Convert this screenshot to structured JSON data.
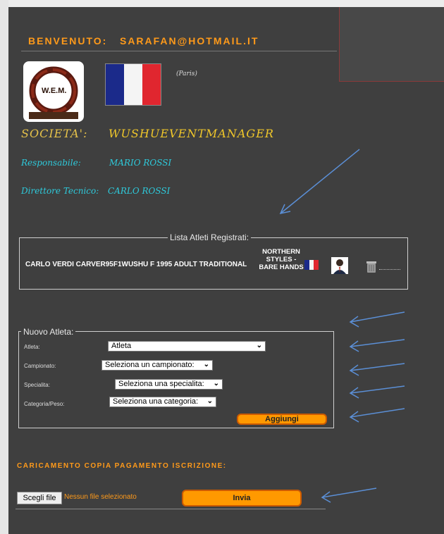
{
  "header": {
    "welcome_label": "BENVENUTO:",
    "user_email": "SARAFAN@HOTMAIL.IT"
  },
  "logo": {
    "text": "W.E.M."
  },
  "location": {
    "city": "(Paris)"
  },
  "society": {
    "societa_label": "SOCIETA':",
    "societa_value": "WUSHUEVENTMANAGER",
    "responsabile_label": "Responsabile:",
    "responsabile_value": "MARIO ROSSI",
    "direttore_label": "Direttore Tecnico:",
    "direttore_value": "CARLO ROSSI"
  },
  "registered": {
    "legend": "Lista Atleti Registrati:",
    "rows": [
      {
        "text": "CARLO VERDI CARVER95F1WUSHU F 1995 ADULT TRADITIONAL",
        "style": "NORTHERN STYLES - BARE HANDS"
      }
    ]
  },
  "new_athlete": {
    "legend": "Nuovo Atleta:",
    "atleta_label": "Atleta:",
    "atleta_value": "Atleta",
    "campionato_label": "Campionato:",
    "campionato_value": "Seleziona un campionato:",
    "specialita_label": "Specialita:",
    "specialita_value": "Seleziona una specialita:",
    "categoria_label": "Categoria/Peso:",
    "categoria_value": "Seleziona una categoria:",
    "add_button": "Aggiungi"
  },
  "upload": {
    "title": "CARICAMENTO COPIA PAGAMENTO ISCRIZIONE:",
    "choose_button": "Scegli file",
    "file_status": "Nessun file selezionato",
    "send_button": "Invia"
  },
  "colors": {
    "accent_orange": "#ff9900",
    "title_orange": "#ff9a1a",
    "cyan": "#2ecadb",
    "gold": "#f0c72a",
    "panel": "#3f3f3f"
  }
}
